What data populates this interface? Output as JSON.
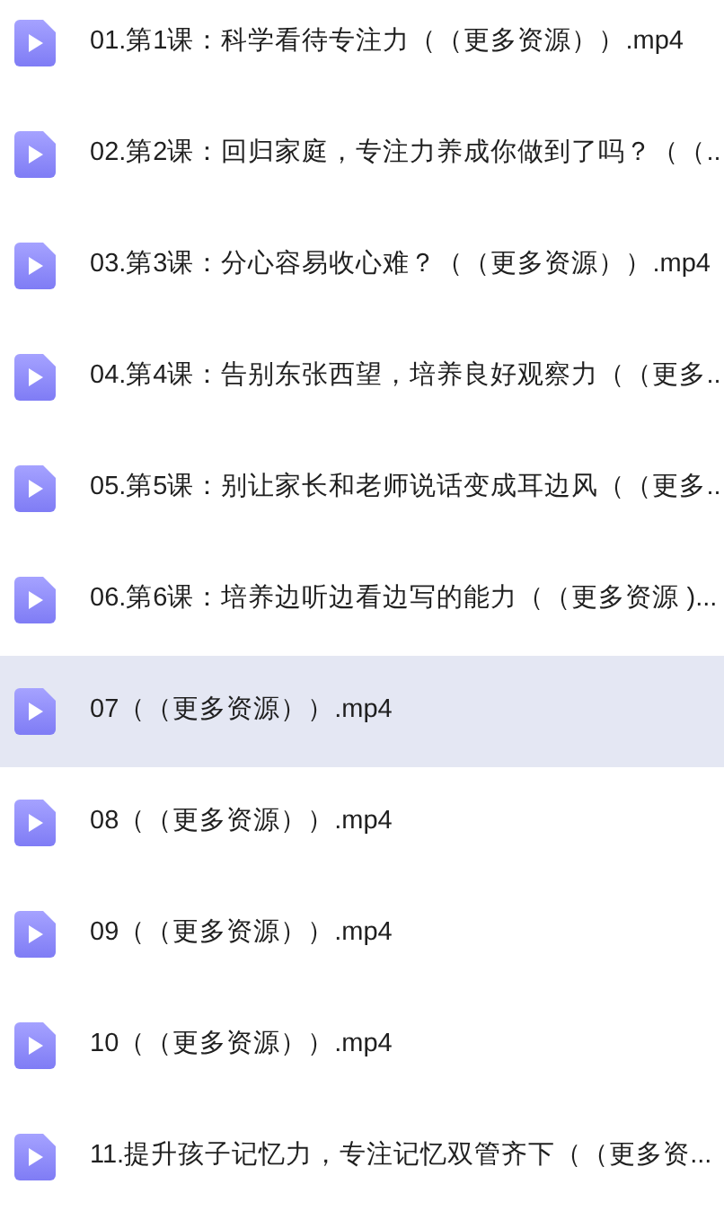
{
  "files": [
    {
      "name": "01.第1课：科学看待专注力（（更多资源））.mp4",
      "selected": false
    },
    {
      "name": "02.第2课：回归家庭，专注力养成你做到了吗？（（..",
      "selected": false
    },
    {
      "name": "03.第3课：分心容易收心难？（（更多资源））.mp4",
      "selected": false
    },
    {
      "name": "04.第4课：告别东张西望，培养良好观察力（（更多..",
      "selected": false
    },
    {
      "name": "05.第5课：别让家长和老师说话变成耳边风（（更多..",
      "selected": false
    },
    {
      "name": "06.第6课：培养边听边看边写的能力（（更多资源 )...",
      "selected": false
    },
    {
      "name": "07（（更多资源））.mp4",
      "selected": true
    },
    {
      "name": "08（（更多资源））.mp4",
      "selected": false
    },
    {
      "name": "09（（更多资源））.mp4",
      "selected": false
    },
    {
      "name": "10（（更多资源））.mp4",
      "selected": false
    },
    {
      "name": "11.提升孩子记忆力，专注记忆双管齐下（（更多资...",
      "selected": false
    }
  ]
}
